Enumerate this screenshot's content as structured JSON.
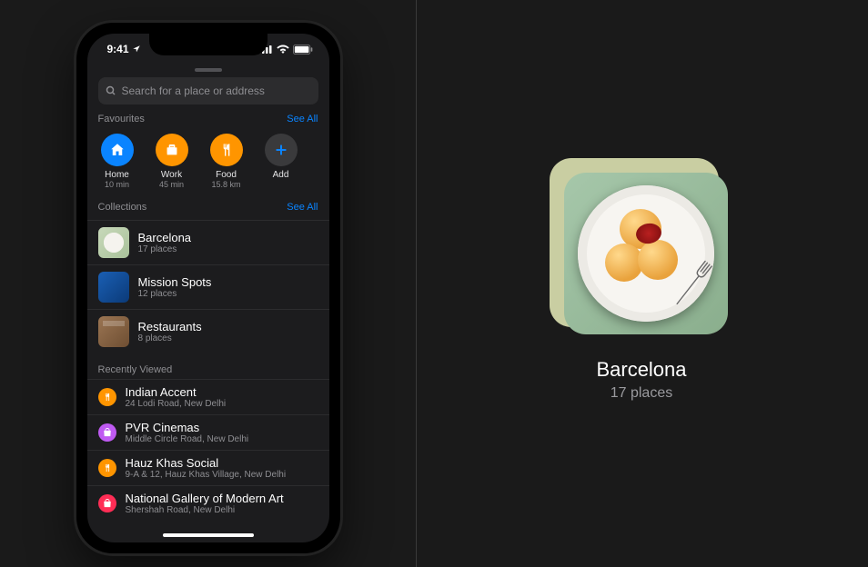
{
  "status_bar": {
    "time": "9:41"
  },
  "search": {
    "placeholder": "Search for a place or address"
  },
  "favourites": {
    "title": "Favourites",
    "see_all": "See All",
    "items": [
      {
        "label": "Home",
        "sub": "10 min",
        "color": "#0a84ff",
        "icon": "house"
      },
      {
        "label": "Work",
        "sub": "45 min",
        "color": "#ff9500",
        "icon": "briefcase"
      },
      {
        "label": "Food",
        "sub": "15.8 km",
        "color": "#ff9500",
        "icon": "fork-knife"
      },
      {
        "label": "Add",
        "sub": "",
        "color": "#3a3a3c",
        "icon": "plus"
      }
    ]
  },
  "collections": {
    "title": "Collections",
    "see_all": "See All",
    "items": [
      {
        "title": "Barcelona",
        "sub": "17 places"
      },
      {
        "title": "Mission Spots",
        "sub": "12 places"
      },
      {
        "title": "Restaurants",
        "sub": "8 places"
      }
    ]
  },
  "recent": {
    "title": "Recently Viewed",
    "items": [
      {
        "title": "Indian Accent",
        "sub": "24 Lodi Road, New Delhi",
        "color": "#ff9500",
        "icon": "fork-knife"
      },
      {
        "title": "PVR Cinemas",
        "sub": "Middle Circle Road, New Delhi",
        "color": "#bf5af2",
        "icon": "shopping-bag"
      },
      {
        "title": "Hauz Khas Social",
        "sub": "9-A & 12, Hauz Khas Village, New Delhi",
        "color": "#ff9500",
        "icon": "fork-knife"
      },
      {
        "title": "National Gallery of Modern Art",
        "sub": "Shershah Road, New Delhi",
        "color": "#ff2d55",
        "icon": "shopping-bag"
      }
    ]
  },
  "detail_card": {
    "title": "Barcelona",
    "sub": "17 places"
  }
}
